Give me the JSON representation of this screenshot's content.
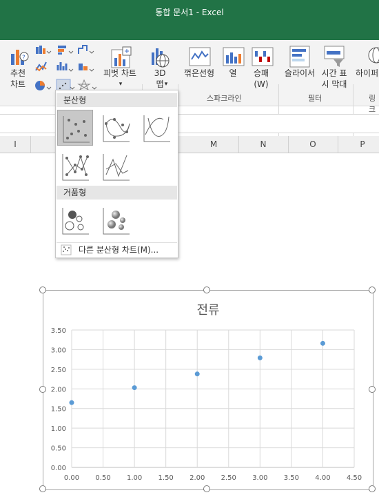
{
  "window": {
    "title": "통합 문서1  -  Excel"
  },
  "ribbon": {
    "recommended_chart": "추천\n차트",
    "pivot_chart": "피벗 차트",
    "map3d": "3D\n맵",
    "sparkline_line": "꺾은선형",
    "sparkline_column": "열",
    "sparkline_winloss": "승패\n(W)",
    "slicer": "슬라이서",
    "timeline": "시간 표\n시 막대",
    "hyperlink": "하이퍼",
    "group_sparkline": "스파크라인",
    "group_filter": "필터",
    "group_link": "링크"
  },
  "columns": [
    "I",
    "M",
    "N",
    "O",
    "P"
  ],
  "dropdown": {
    "section1": "분산형",
    "section2": "거품형",
    "more": "다른 분산형 차트(M)..."
  },
  "chart_data": {
    "type": "scatter",
    "title": "전류",
    "x": [
      0,
      1,
      2,
      3,
      4
    ],
    "y": [
      1.65,
      2.03,
      2.38,
      2.79,
      3.16
    ],
    "xlim": [
      0,
      4.5
    ],
    "ylim": [
      0,
      3.5
    ],
    "xticks": [
      "0.00",
      "0.50",
      "1.00",
      "1.50",
      "2.00",
      "2.50",
      "3.00",
      "3.50",
      "4.00",
      "4.50"
    ],
    "yticks": [
      "0.00",
      "0.50",
      "1.00",
      "1.50",
      "2.00",
      "2.50",
      "3.00",
      "3.50"
    ],
    "grid": true,
    "marker_color": "#5b9bd5"
  }
}
